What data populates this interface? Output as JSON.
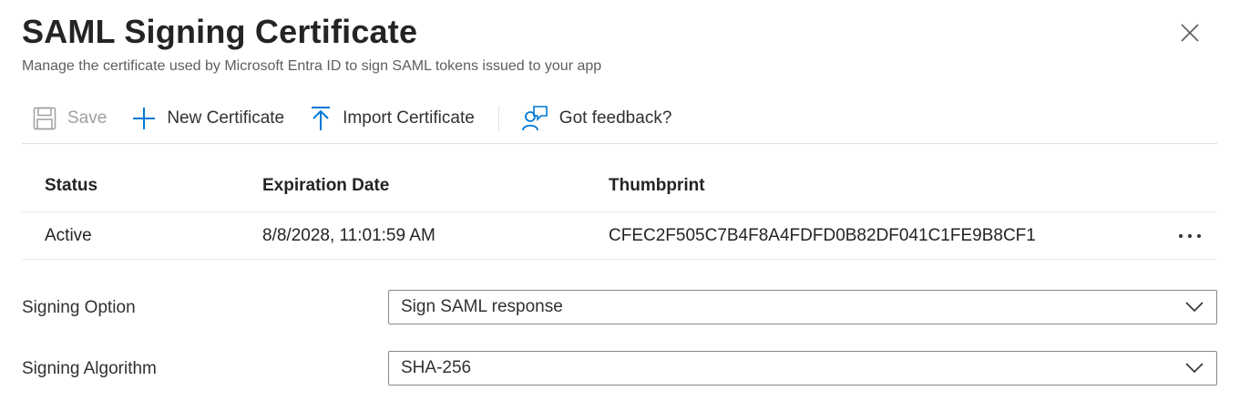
{
  "header": {
    "title": "SAML Signing Certificate",
    "subtitle": "Manage the certificate used by Microsoft Entra ID to sign SAML tokens issued to your app"
  },
  "toolbar": {
    "save_label": "Save",
    "new_label": "New Certificate",
    "import_label": "Import Certificate",
    "feedback_label": "Got feedback?"
  },
  "table": {
    "headers": {
      "status": "Status",
      "expiration": "Expiration Date",
      "thumbprint": "Thumbprint"
    },
    "rows": [
      {
        "status": "Active",
        "expiration": "8/8/2028, 11:01:59 AM",
        "thumbprint": "CFEC2F505C7B4F8A4FDFD0B82DF041C1FE9B8CF1",
        "more": "•••"
      }
    ]
  },
  "fields": {
    "signing_option": {
      "label": "Signing Option",
      "value": "Sign SAML response"
    },
    "signing_algorithm": {
      "label": "Signing Algorithm",
      "value": "SHA-256"
    }
  },
  "icons": {
    "close": "close-icon",
    "save": "save-icon",
    "new": "plus-icon",
    "import": "upload-icon",
    "feedback": "feedback-icon",
    "more": "more-icon",
    "dropdown": "chevron-down-icon"
  },
  "colors": {
    "accent": "#0078d4",
    "text": "#242424",
    "secondary_text": "#605e5c",
    "disabled": "#a19f9d",
    "border": "#8a8886",
    "divider": "#e1dfdd"
  }
}
